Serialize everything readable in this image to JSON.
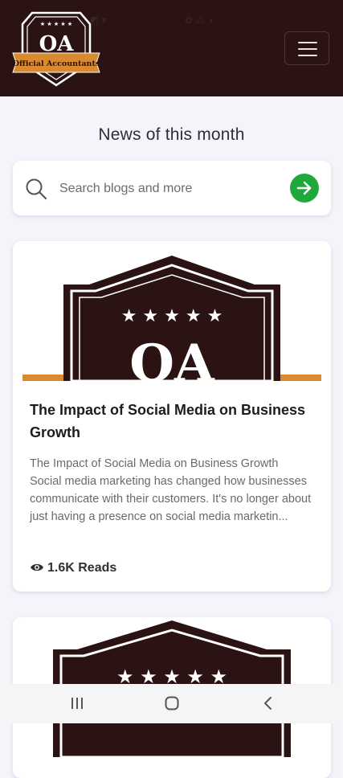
{
  "header": {
    "logo_initials": "OA",
    "logo_banner": "Official Accountants",
    "colors": {
      "background": "#2b1314",
      "banner": "#d98a2e"
    }
  },
  "status_bar": {
    "left_icons": "◩ ▾",
    "right_icons": "✿ ⁂ ◖"
  },
  "main": {
    "title": "News of this month",
    "search": {
      "placeholder": "Search blogs and more",
      "value": "",
      "button_color": "#1ea93a"
    }
  },
  "posts": [
    {
      "title": "The Impact of Social Media on Business Growth",
      "excerpt": "The Impact of Social Media on Business Growth\n Social media marketing has changed how businesses communicate with their customers. It's no longer about just having a presence on social media marketin...",
      "reads": "1.6K Reads",
      "image_initials": "OA"
    },
    {
      "title": "",
      "excerpt": "",
      "reads": "",
      "image_initials": "OA"
    }
  ],
  "system_nav": {
    "icons": [
      "recent-apps-icon",
      "home-icon",
      "back-icon"
    ]
  }
}
